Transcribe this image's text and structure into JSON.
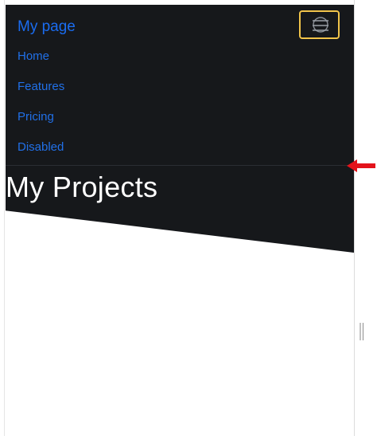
{
  "navbar": {
    "brand": "My page",
    "toggler_icon": "hamburger-icon",
    "items": [
      {
        "label": "Home"
      },
      {
        "label": "Features"
      },
      {
        "label": "Pricing"
      },
      {
        "label": "Disabled"
      }
    ]
  },
  "hero": {
    "title": "My Projects"
  },
  "annotations": {
    "pointer_icon": "red-arrow-icon"
  },
  "colors": {
    "navbar_bg": "#16181b",
    "link": "#2170e8",
    "brand": "#1a6cf0",
    "toggler_border": "#f1c44a",
    "arrow": "#e3131b"
  }
}
